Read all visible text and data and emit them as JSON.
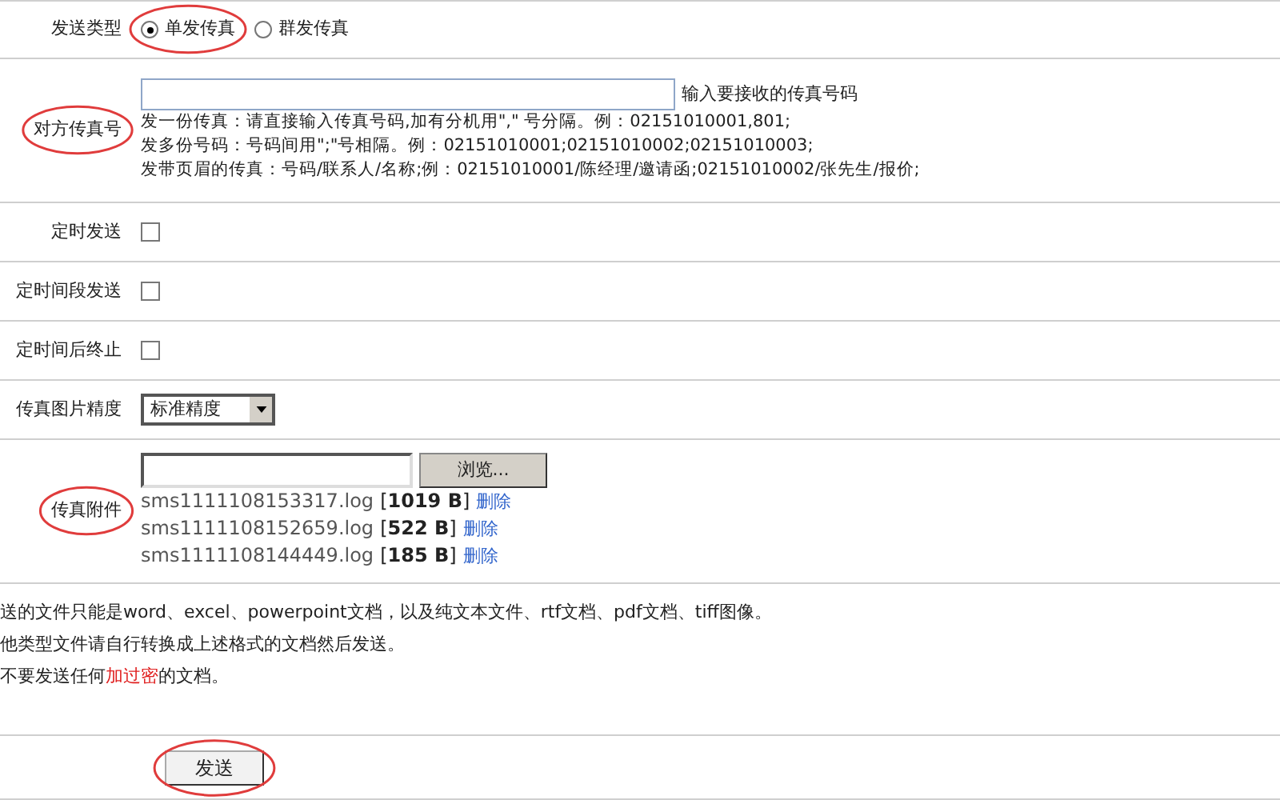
{
  "send_type": {
    "label": "发送类型",
    "circled": false,
    "options": [
      {
        "label": "单发传真",
        "selected": true,
        "circled": true
      },
      {
        "label": "群发传真",
        "selected": false,
        "circled": false
      }
    ]
  },
  "fax_number": {
    "label": "对方传真号",
    "circled": true,
    "hint": "输入要接收的传真号码",
    "help": [
      "发一份传真：请直接输入传真号码,加有分机用\",\" 号分隔。例：02151010001,801;",
      "发多份号码：号码间用\";\"号相隔。例：02151010001;02151010002;02151010003;",
      "发带页眉的传真：号码/联系人/名称;例：02151010001/陈经理/邀请函;02151010002/张先生/报价;"
    ]
  },
  "options": [
    {
      "label": "定时发送",
      "checked": false
    },
    {
      "label": "定时间段发送",
      "checked": false
    },
    {
      "label": "定时间后终止",
      "checked": false
    }
  ],
  "precision": {
    "label": "传真图片精度",
    "value": "标准精度"
  },
  "attachment": {
    "label": "传真附件",
    "circled": true,
    "browse": "浏览...",
    "files": [
      {
        "name": "sms1111108153317.log",
        "size": "[**1019 B**]",
        "delete": "删除"
      },
      {
        "name": "sms1111108152659.log",
        "size": "[**522 B**]",
        "delete": "删除"
      },
      {
        "name": "sms1111108144449.log",
        "size": "[**185 B**]",
        "delete": "删除"
      }
    ]
  },
  "notes": [
    [
      {
        "text": "送的文件只能是word、excel、powerpoint文档，以及纯文本文件、rtf文档、pdf文档、tiff图像。",
        "red": false
      }
    ],
    [
      {
        "text": "他类型文件请自行转换成上述格式的文档然后发送。",
        "red": false
      }
    ],
    [
      {
        "text": "不要发送任何",
        "red": false
      },
      {
        "text": "加过密",
        "red": true
      },
      {
        "text": "的文档。",
        "red": false
      }
    ]
  ],
  "send_button": {
    "label": "发送",
    "circled": true
  }
}
